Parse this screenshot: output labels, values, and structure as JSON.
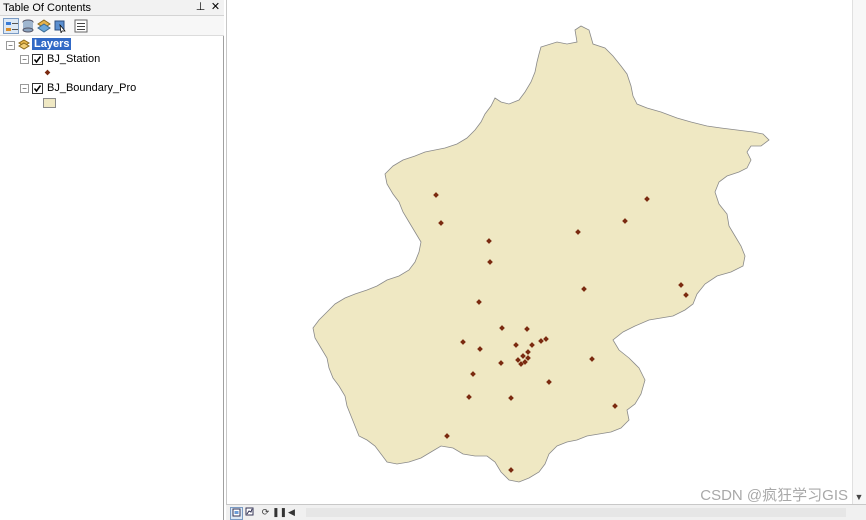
{
  "toc": {
    "title": "Table Of Contents",
    "pin_glyph": "⊥",
    "close_glyph": "✕",
    "tools": [
      {
        "name": "list-by-drawing-order",
        "active": true
      },
      {
        "name": "list-by-source",
        "active": false
      },
      {
        "name": "list-by-visibility",
        "active": false
      },
      {
        "name": "list-by-selection",
        "active": false
      },
      {
        "name": "options",
        "active": false
      }
    ],
    "root": {
      "label": "Layers",
      "expander": "−"
    },
    "layers": [
      {
        "label": "BJ_Station",
        "checked": true,
        "expander": "−",
        "symbol": "point-marker",
        "symbol_color": "#7a2a10"
      },
      {
        "label": "BJ_Boundary_Pro",
        "checked": true,
        "expander": "−",
        "symbol": "polygon-fill",
        "symbol_color": "#efe8c3"
      }
    ]
  },
  "map": {
    "fill_color": "#efe8c3",
    "outline_color": "#8a8a8a",
    "point_color": "#7a2a10",
    "station_count": 34
  },
  "statusbar": {
    "buttons": [
      "layout-view",
      "data-view",
      "refresh",
      "pause",
      "scroll-left"
    ],
    "scroll_left": "◀",
    "scroll_down": "▼"
  },
  "watermark": "CSDN @疯狂学习GIS"
}
